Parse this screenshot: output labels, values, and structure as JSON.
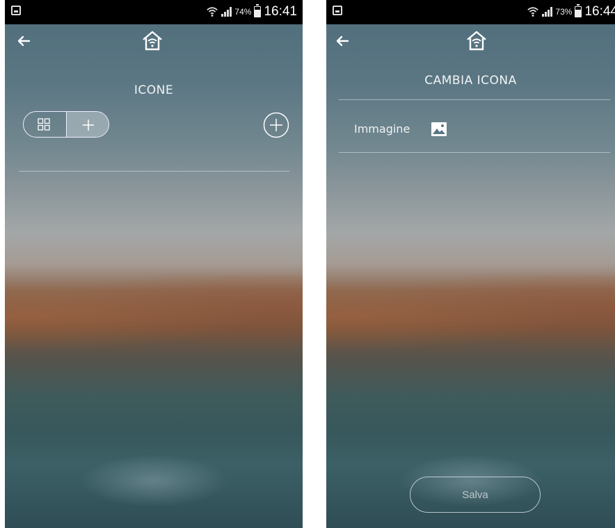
{
  "left_screen": {
    "status": {
      "battery_pct": "74%",
      "time": "16:41"
    },
    "title": "ICONE"
  },
  "right_screen": {
    "status": {
      "battery_pct": "73%",
      "time": "16:44"
    },
    "title": "CAMBIA ICONA",
    "image_label": "Immagine",
    "save_label": "Salva"
  },
  "icons": {
    "back": "arrow-left-icon",
    "home": "home-wifi-icon",
    "grid": "grid-icon",
    "plus": "plus-icon",
    "add": "plus-circle-icon",
    "image": "image-icon"
  }
}
